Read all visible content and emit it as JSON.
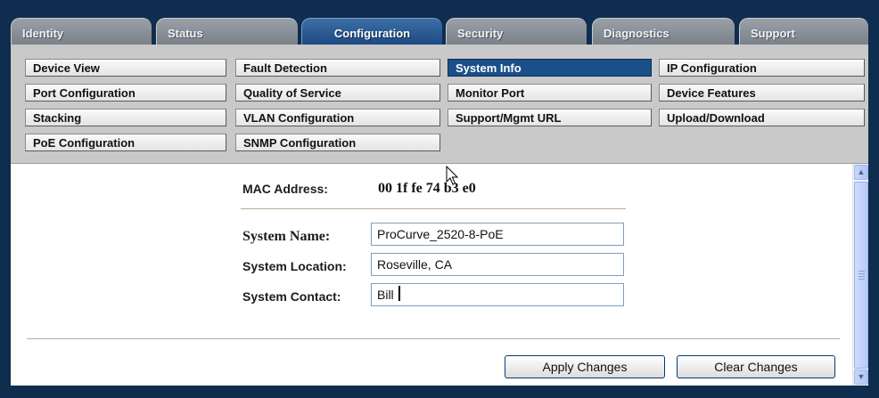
{
  "tabs": [
    {
      "label": "Identity",
      "active": false
    },
    {
      "label": "Status",
      "active": false
    },
    {
      "label": "Configuration",
      "active": true
    },
    {
      "label": "Security",
      "active": false
    },
    {
      "label": "Diagnostics",
      "active": false
    },
    {
      "label": "Support",
      "active": false
    }
  ],
  "subnav": {
    "rows": [
      [
        "Device View",
        "Fault Detection",
        "System Info",
        "IP Configuration"
      ],
      [
        "Port Configuration",
        "Quality of Service",
        "Monitor Port",
        "Device Features"
      ],
      [
        "Stacking",
        "VLAN Configuration",
        "Support/Mgmt URL",
        "Upload/Download"
      ],
      [
        "PoE Configuration",
        "SNMP Configuration"
      ]
    ],
    "selected": "System Info"
  },
  "form": {
    "mac_label": "MAC Address:",
    "mac_value": "00 1f fe 74 b3 e0",
    "system_name_label": "System Name:",
    "system_name_value": "ProCurve_2520-8-PoE",
    "system_location_label": "System Location:",
    "system_location_value": "Roseville, CA",
    "system_contact_label": "System Contact:",
    "system_contact_value": "Bill"
  },
  "buttons": {
    "apply_label": "Apply Changes",
    "clear_label": "Clear Changes"
  },
  "colors": {
    "frame": "#0f2d4f",
    "active_tab": "#1d4a84",
    "selected_subnav": "#1a4f8a",
    "subnav_panel": "#c9c9c9"
  }
}
